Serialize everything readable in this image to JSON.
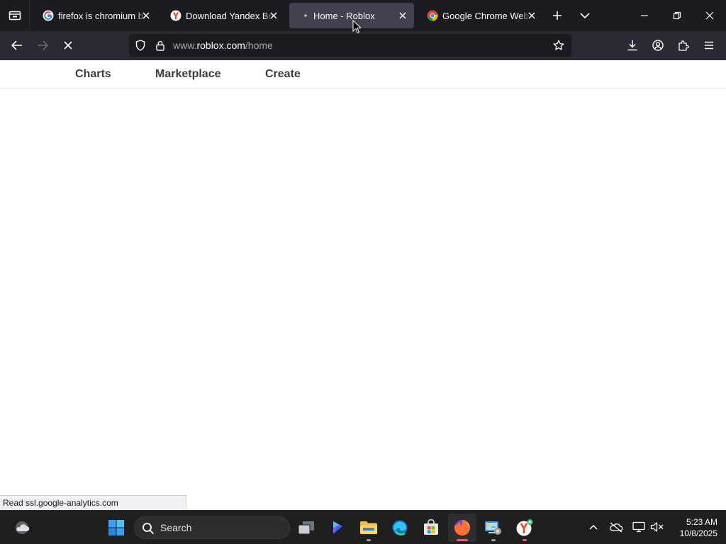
{
  "tabs": [
    {
      "title": "firefox is chromium bas",
      "favicon": "google-icon",
      "active": false
    },
    {
      "title": "Download Yandex Brow",
      "favicon": "yandex-icon",
      "active": false
    },
    {
      "title": "Home - Roblox",
      "favicon": "loading-dot-icon",
      "active": true
    },
    {
      "title": "Google Chrome Web B",
      "favicon": "chrome-icon",
      "active": false
    }
  ],
  "urlbar": {
    "url_prefix": "www.",
    "url_domain": "roblox.com",
    "url_path": "/home"
  },
  "site_nav": {
    "charts": "Charts",
    "marketplace": "Marketplace",
    "create": "Create"
  },
  "status": {
    "text": "Read ssl.google-analytics.com"
  },
  "taskbar": {
    "search_label": "Search",
    "time": "5:23 AM",
    "date": "10/8/2025"
  },
  "colors": {
    "tabstrip": "#1c1b22",
    "active_tab": "#42414d",
    "navbar": "#2b2a33",
    "urlbar": "#1c1b22",
    "taskbar": "#1f1f1f",
    "site_nav_text": "#393b3d"
  }
}
